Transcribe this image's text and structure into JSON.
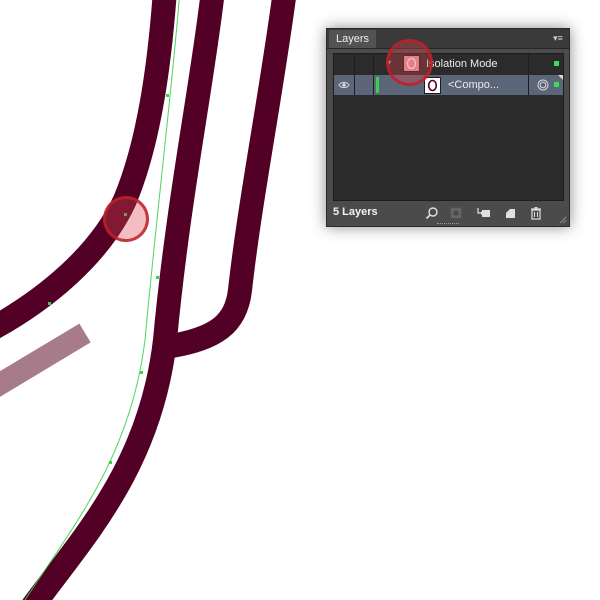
{
  "colors": {
    "stroke_dark": "#520025",
    "stroke_muted": "#a87b8b",
    "anchor_green": "#38d14a",
    "panel_bg": "#4b4b4b",
    "list_bg": "#2b2b2b",
    "selected_row": "#5b6679",
    "highlight_red": "#c0202a"
  },
  "layers_panel": {
    "tab_label": "Layers",
    "menu_icon": "panel-menu-icon",
    "rows": [
      {
        "name": "Isolation Mode",
        "disclosure": "▾",
        "selected": false
      },
      {
        "name": "<Compo...",
        "selected": true,
        "visible": true,
        "targeted": true
      }
    ],
    "layer_count": "5 Layers",
    "footer_icons": [
      "locate-object-icon",
      "make-clipping-mask-icon",
      "create-sublayer-icon",
      "create-layer-icon",
      "delete-icon"
    ]
  }
}
